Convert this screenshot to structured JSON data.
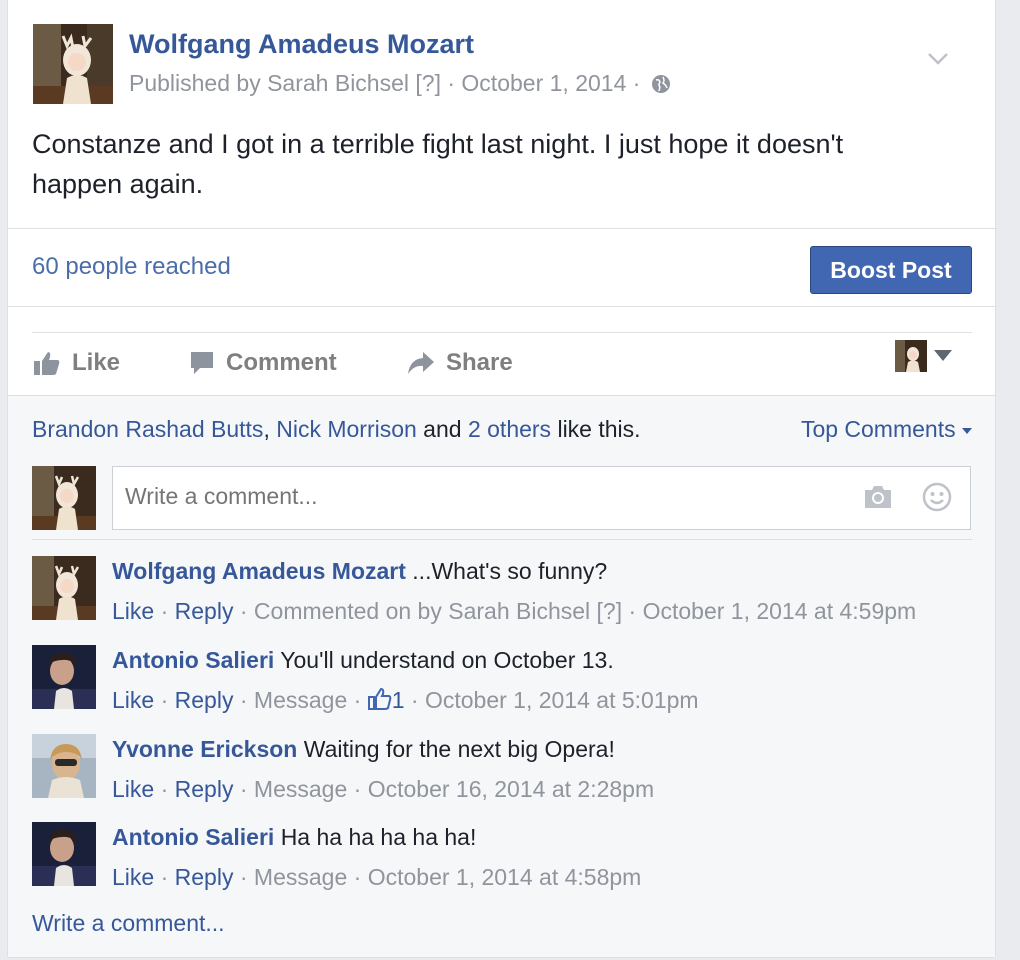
{
  "post": {
    "author": "Wolfgang Amadeus Mozart",
    "published_by": "Published by Sarah Bichsel",
    "help_marker": "[?]",
    "date": "October 1, 2014",
    "text": "Constanze and I got in a terrible fight last night. I just hope it doesn't happen again."
  },
  "stats": {
    "reach": "60 people reached",
    "boost_label": "Boost Post"
  },
  "actions": {
    "like": "Like",
    "comment": "Comment",
    "share": "Share"
  },
  "likes": {
    "person1": "Brandon Rashad Butts",
    "comma": ", ",
    "person2": "Nick Morrison",
    "and": " and ",
    "others": "2 others",
    "suffix": " like this."
  },
  "sort": {
    "label": "Top Comments"
  },
  "composer": {
    "placeholder": "Write a comment..."
  },
  "comments": [
    {
      "name": "Wolfgang Amadeus Mozart",
      "text": "...What's so funny?",
      "like": "Like",
      "reply": "Reply",
      "extra": "Commented on by Sarah Bichsel [?]",
      "time": "October 1, 2014 at 4:59pm"
    },
    {
      "name": "Antonio Salieri",
      "text": "You'll understand on October 13.",
      "like": "Like",
      "reply": "Reply",
      "extra": "Message",
      "like_count": "1",
      "time": "October 1, 2014 at 5:01pm"
    },
    {
      "name": "Yvonne Erickson",
      "text": "Waiting for the next big Opera!",
      "like": "Like",
      "reply": "Reply",
      "extra": "Message",
      "time": "October 16, 2014 at 2:28pm"
    },
    {
      "name": "Antonio Salieri",
      "text": "Ha ha ha ha ha ha!",
      "like": "Like",
      "reply": "Reply",
      "extra": "Message",
      "time": "October 1, 2014 at 4:58pm"
    }
  ],
  "footer": {
    "write_comment": "Write a comment..."
  },
  "colors": {
    "link": "#365899",
    "boost": "#4267b2",
    "muted": "#90949c",
    "background": "#e9ebee"
  }
}
